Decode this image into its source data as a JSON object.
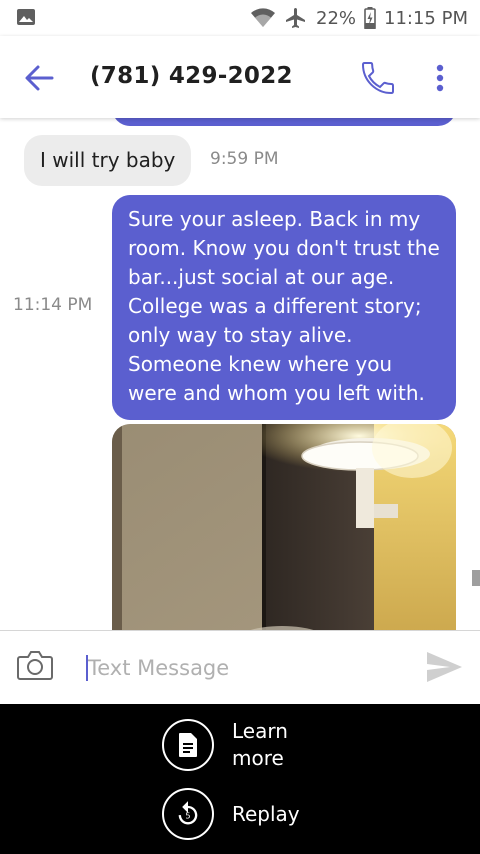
{
  "status_bar": {
    "battery": "22%",
    "time": "11:15 PM",
    "icons": [
      "gallery-icon",
      "wifi-icon",
      "airplane-icon",
      "battery-charging-icon"
    ]
  },
  "app_bar": {
    "title": "(781) 429-2022",
    "icons": [
      "back-arrow-icon",
      "phone-icon",
      "more-vert-icon"
    ]
  },
  "messages": [
    {
      "direction": "incoming",
      "text": "I will try baby",
      "time": "9:59 PM"
    },
    {
      "direction": "outgoing",
      "text": "Sure your asleep. Back in my room. Know you don't trust the bar...just social at our age. College was a different story; only way to stay alive. Someone knew where you were and whom you left with.",
      "time": "11:14 PM"
    },
    {
      "direction": "outgoing",
      "type": "photo",
      "subject": "wall-lamp"
    }
  ],
  "compose": {
    "placeholder": "Text Message",
    "value": "",
    "icons": [
      "camera-icon",
      "send-icon"
    ]
  },
  "ad_bar": {
    "learn_more": "Learn more",
    "replay": "Replay",
    "icons": [
      "document-icon",
      "replay-icon"
    ]
  },
  "colors": {
    "accent": "#5b5fcf",
    "incoming_bubble": "#ececec",
    "ad_background": "#000000"
  }
}
